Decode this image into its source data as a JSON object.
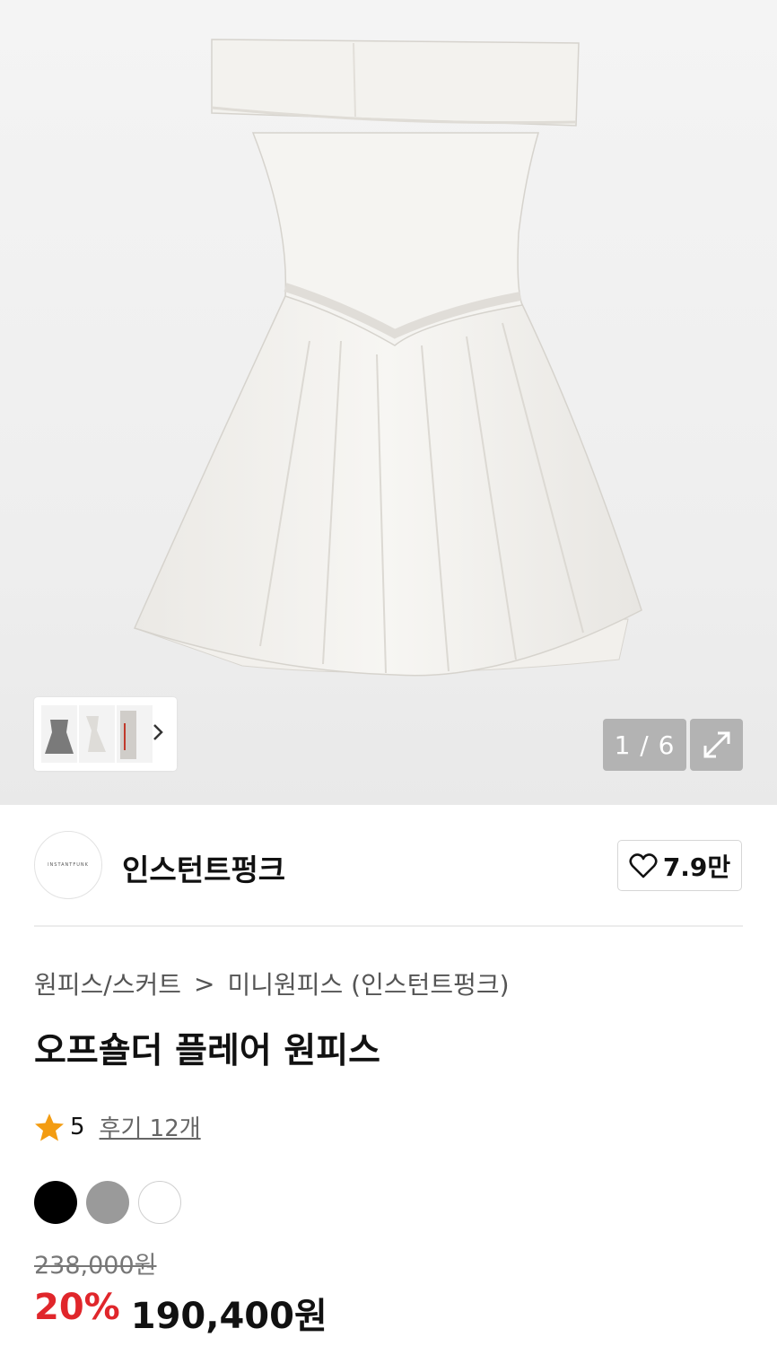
{
  "gallery": {
    "counter": "1 / 6",
    "thumbnails": [
      "dress-dark-thumbnail",
      "dress-white-thumbnail",
      "dress-detail-thumbnail"
    ]
  },
  "brand": {
    "logo_text": "INSTANTFUNK",
    "name": "인스턴트펑크",
    "likes": "7.9만"
  },
  "breadcrumb": {
    "category": "원피스/스커트",
    "separator": ">",
    "subcategory": "미니원피스 (인스턴트펑크)"
  },
  "product": {
    "title": "오프숄더 플레어 원피스",
    "rating": "5",
    "reviews": "후기 12개",
    "colors": [
      "#000000",
      "#9a9a9a",
      "#ffffff"
    ],
    "original_price": "238,000원",
    "discount": "20%",
    "sale_price": "190,400원"
  },
  "theme": {
    "discount_color": "#e0262b",
    "star_color": "#f39c12"
  }
}
